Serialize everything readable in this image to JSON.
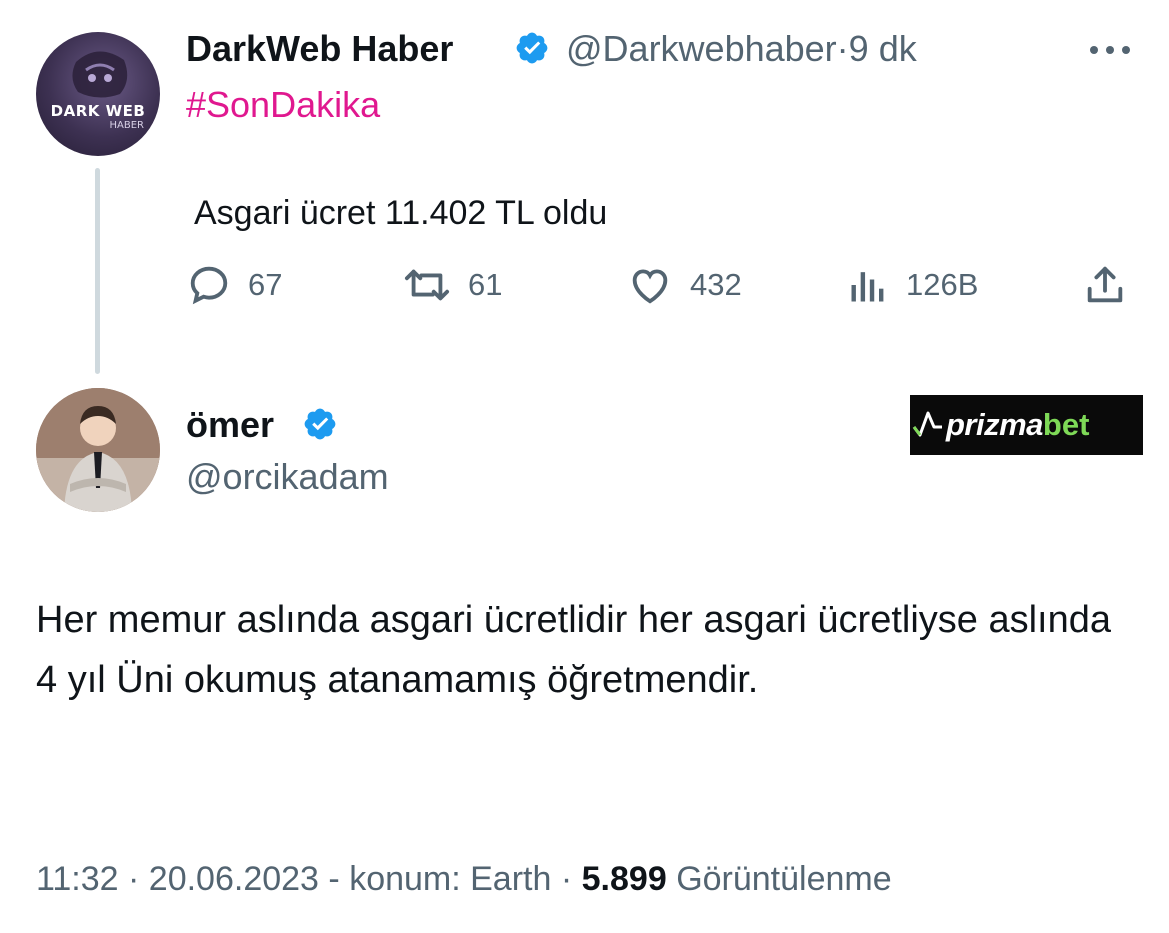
{
  "parent_tweet": {
    "avatar_text": "DARK WEB",
    "avatar_subtext": "HABER",
    "author_name": "DarkWeb Haber",
    "author_handle": "@Darkwebhaber",
    "separator": "·",
    "time_ago": "9 dk",
    "hashtag": "#SonDakika",
    "text": "Asgari ücret 11.402 TL oldu",
    "actions": {
      "replies": "67",
      "retweets": "61",
      "likes": "432",
      "views": "126B"
    },
    "verified": true
  },
  "reply_tweet": {
    "author_name": "ömer",
    "author_handle": "@orcikadam",
    "verified": true,
    "ad": {
      "brand_main": "prizma",
      "brand_accent": "bet"
    },
    "text": "Her memur aslında asgari ücretlidir her asgari ücretliyse aslında 4 yıl Üni okumuş atanamamış öğretmendir.",
    "meta": {
      "time": "11:32",
      "sep1": "·",
      "date": "20.06.2023",
      "location_text": "- konum: Earth",
      "sep2": "·",
      "views_count": "5.899",
      "views_label": "Görüntülenme"
    }
  },
  "colors": {
    "hashtag": "#e0188f",
    "verified_badge": "#1d9bf0",
    "muted_text": "#536471",
    "primary_text": "#0f1419",
    "ad_accent": "#7ed957"
  },
  "icons": [
    "more-icon",
    "verified-badge-icon",
    "reply-icon",
    "retweet-icon",
    "like-icon",
    "views-icon",
    "share-icon"
  ]
}
